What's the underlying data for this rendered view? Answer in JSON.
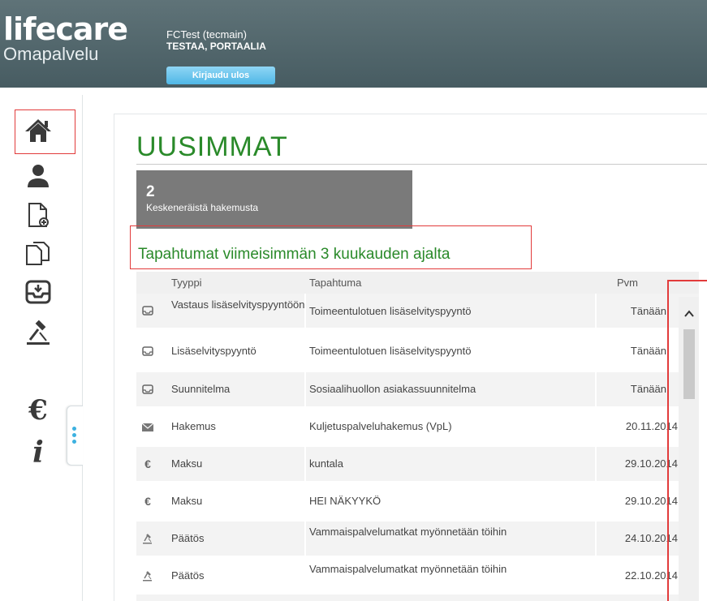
{
  "header": {
    "brand": "lifecare",
    "brand_sub": "Omapalvelu",
    "user_account": "FCTest (tecmain)",
    "user_name": "TESTAA, PORTAALIA",
    "logout_label": "Kirjaudu ulos"
  },
  "sidebar": {
    "items": [
      {
        "icon": "home-icon"
      },
      {
        "icon": "person-icon"
      },
      {
        "icon": "new-document-icon"
      },
      {
        "icon": "documents-icon"
      },
      {
        "icon": "inbox-icon"
      },
      {
        "icon": "gavel-icon"
      },
      {
        "icon": "euro-icon",
        "glyph": "€"
      },
      {
        "icon": "info-icon",
        "glyph": "i"
      }
    ]
  },
  "main": {
    "title": "UUSIMMAT",
    "stat": {
      "number": "2",
      "label": "Keskeneräistä hakemusta"
    },
    "events_heading": "Tapahtumat viimeisimmän 3 kuukauden ajalta",
    "table": {
      "columns": [
        "Tyyppi",
        "Tapahtuma",
        "Pvm"
      ],
      "rows": [
        {
          "icon": "inbox-icon",
          "type": "Vastaus lisäselvityspyyntöön",
          "event": "Toimeentulotuen lisäselvityspyyntö",
          "date": "Tänään"
        },
        {
          "icon": "inbox-icon",
          "type": "Lisäselvityspyyntö",
          "event": "Toimeentulotuen lisäselvityspyyntö",
          "date": "Tänään"
        },
        {
          "icon": "inbox-icon",
          "type": "Suunnitelma",
          "event": "Sosiaalihuollon asiakassuunnitelma",
          "date": "Tänään"
        },
        {
          "icon": "envelope-icon",
          "type": "Hakemus",
          "event": "Kuljetuspalveluhakemus (VpL)",
          "date": "20.11.2014"
        },
        {
          "icon": "euro-icon",
          "type": "Maksu",
          "event": "kuntala",
          "date": "29.10.2014"
        },
        {
          "icon": "euro-icon",
          "type": "Maksu",
          "event": "HEI NÄKYYKÖ",
          "date": "29.10.2014"
        },
        {
          "icon": "gavel-icon",
          "type": "Päätös",
          "event": "Vammaispalvelumatkat myönnetään töihin",
          "date": "24.10.2014"
        },
        {
          "icon": "gavel-icon",
          "type": "Päätös",
          "event": "Vammaispalvelumatkat myönnetään töihin",
          "date": "22.10.2014"
        }
      ]
    }
  },
  "colors": {
    "header": "#4f6468",
    "accent_green": "#2a8a2a",
    "logout_blue": "#4fb7e6",
    "highlight_red": "#e23b3b",
    "tile_gray": "#7a7a7a"
  }
}
